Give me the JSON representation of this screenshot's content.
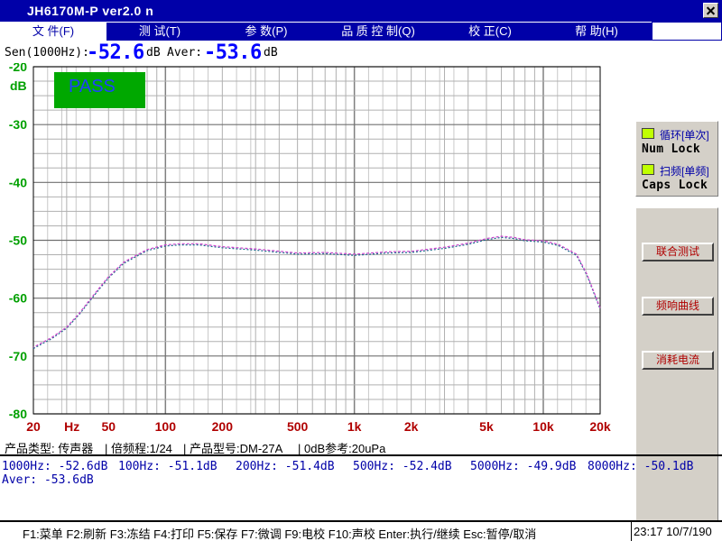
{
  "window": {
    "title": "JH6170M-P    ver2.0  n"
  },
  "menu": [
    {
      "label": "文 件(F)",
      "active": true
    },
    {
      "label": "测 试(T)",
      "active": false
    },
    {
      "label": "参 数(P)",
      "active": false
    },
    {
      "label": "品 质 控 制(Q)",
      "active": false
    },
    {
      "label": "校 正(C)",
      "active": false
    },
    {
      "label": "帮 助(H)",
      "active": false
    }
  ],
  "readout": {
    "sen_label": "Sen(1000Hz):",
    "sen_value": "-52.6",
    "sen_unit": "dB",
    "aver_label": "Aver:",
    "aver_value": "-53.6",
    "aver_unit": "dB"
  },
  "chart_data": {
    "type": "line",
    "x_scale": "log",
    "xlim": [
      20,
      20000
    ],
    "ylim": [
      -80,
      -20
    ],
    "ylabel": "dB",
    "xlabel": "Hz",
    "x_ticks": [
      {
        "value": 20,
        "label": "20"
      },
      {
        "value": 50,
        "label": "50"
      },
      {
        "value": 100,
        "label": "100"
      },
      {
        "value": 200,
        "label": "200"
      },
      {
        "value": 500,
        "label": "500"
      },
      {
        "value": 1000,
        "label": "1k"
      },
      {
        "value": 2000,
        "label": "2k"
      },
      {
        "value": 5000,
        "label": "5k"
      },
      {
        "value": 10000,
        "label": "10k"
      },
      {
        "value": 20000,
        "label": "20k"
      }
    ],
    "y_ticks": [
      {
        "value": -20,
        "label": "-20"
      },
      {
        "value": -30,
        "label": "-30"
      },
      {
        "value": -40,
        "label": "-40"
      },
      {
        "value": -50,
        "label": "-50"
      },
      {
        "value": -60,
        "label": "-60"
      },
      {
        "value": -70,
        "label": "-70"
      },
      {
        "value": -80,
        "label": "-80"
      }
    ],
    "grid": true,
    "badge": {
      "text": "PASS",
      "color": "#00a800",
      "text_color": "#2040ff"
    },
    "series": [
      {
        "color": "#1a6a8c",
        "x": [
          20,
          25,
          30,
          35,
          40,
          45,
          50,
          60,
          70,
          80,
          100,
          120,
          150,
          200,
          300,
          500,
          700,
          1000,
          1500,
          2000,
          3000,
          4000,
          5000,
          6000,
          7000,
          8000,
          10000,
          12000,
          15000,
          17000,
          20000
        ],
        "y": [
          -68.7,
          -67.0,
          -65.2,
          -62.8,
          -60.4,
          -58.3,
          -56.5,
          -54.0,
          -52.8,
          -51.8,
          -51.0,
          -50.8,
          -50.8,
          -51.3,
          -51.7,
          -52.4,
          -52.3,
          -52.6,
          -52.2,
          -52.1,
          -51.4,
          -50.7,
          -49.9,
          -49.5,
          -49.7,
          -50.1,
          -50.3,
          -50.9,
          -52.6,
          -56.0,
          -61.9
        ]
      },
      {
        "color": "#cc44cc",
        "x": [
          20,
          25,
          30,
          35,
          40,
          45,
          50,
          60,
          70,
          80,
          100,
          120,
          150,
          200,
          300,
          500,
          700,
          1000,
          1500,
          2000,
          3000,
          4000,
          5000,
          6000,
          7000,
          8000,
          10000,
          12000,
          15000,
          17000,
          20000
        ],
        "y": [
          -68.5,
          -66.8,
          -65.0,
          -62.6,
          -60.2,
          -58.1,
          -56.3,
          -53.8,
          -52.6,
          -51.6,
          -50.8,
          -50.6,
          -50.6,
          -51.1,
          -51.5,
          -52.2,
          -52.1,
          -52.4,
          -52.0,
          -51.9,
          -51.2,
          -50.5,
          -49.7,
          -49.3,
          -49.5,
          -49.9,
          -50.1,
          -50.7,
          -52.4,
          -55.8,
          -61.7
        ]
      }
    ]
  },
  "status_panel": {
    "loop": {
      "label": "循环[单次]",
      "color": "#c0ff00"
    },
    "num_lock": "Num  Lock",
    "sweep": {
      "label": "扫频[单频]",
      "color": "#c0ff00"
    },
    "caps_lock": "Caps  Lock"
  },
  "side_buttons": {
    "joint_test": "联合测试",
    "freq_curve": "频响曲线",
    "current": "消耗电流"
  },
  "info_bar": {
    "product_type": "产品类型:   传声器",
    "octave": "| 倍频程:1/24",
    "model": "| 产品型号:DM-27A",
    "reference": "| 0dB参考:20uPa"
  },
  "measurements": {
    "m1000": "1000Hz:  -52.6dB",
    "m100": "100Hz:  -51.1dB",
    "m200": "200Hz:  -51.4dB",
    "m500": "500Hz:  -52.4dB",
    "m5000": "5000Hz:  -49.9dB",
    "m8000": "8000Hz:  -50.1dB",
    "aver": "Aver:  -53.6dB"
  },
  "key_bar": {
    "keys": "F1:菜单  F2:刷新  F3:冻结  F4:打印  F5:保存  F7:微调  F9:电校  F10:声校  Enter:执行/继续    Esc:暂停/取消"
  },
  "clock": {
    "time": "23:17  10/7/190"
  }
}
